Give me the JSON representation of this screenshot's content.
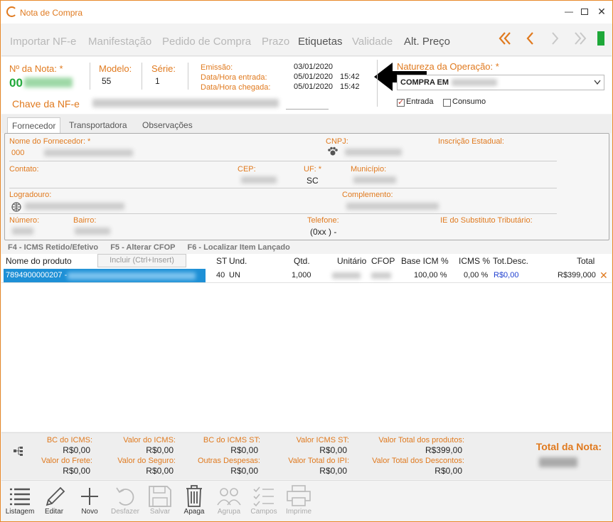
{
  "window": {
    "title": "Nota de Compra"
  },
  "tabs": [
    {
      "label": "Importar NF-e",
      "active": false
    },
    {
      "label": "Manifestação",
      "active": false
    },
    {
      "label": "Pedido de Compra",
      "active": false
    },
    {
      "label": "Prazo",
      "active": false
    },
    {
      "label": "Etiquetas",
      "active": true
    },
    {
      "label": "Validade",
      "active": false
    },
    {
      "label": "Alt. Preço",
      "active": true
    }
  ],
  "header": {
    "nota_label": "Nº da Nota: *",
    "nota_value": "00",
    "modelo_label": "Modelo:",
    "modelo_value": "55",
    "serie_label": "Série:",
    "serie_value": "1",
    "emissao_label": "Emissão:",
    "emissao_value": "03/01/2020",
    "entrada_label": "Data/Hora entrada:",
    "entrada_date": "05/01/2020",
    "entrada_time": "15:42",
    "chegada_label": "Data/Hora chegada:",
    "chegada_date": "05/01/2020",
    "chegada_time": "15:42",
    "chave_label": "Chave da NF-e",
    "natureza_label": "Natureza da Operação: *",
    "natureza_value": "COMPRA EM",
    "entrada_check": "Entrada",
    "consumo_check": "Consumo"
  },
  "subtabs": [
    "Fornecedor",
    "Transportadora",
    "Observações"
  ],
  "fornecedor": {
    "nome_label": "Nome do Fornecedor: *",
    "nome_value": "000",
    "cnpj_label": "CNPJ:",
    "ie_label": "Inscrição Estadual:",
    "contato_label": "Contato:",
    "cep_label": "CEP:",
    "uf_label": "UF: *",
    "uf_value": "SC",
    "municipio_label": "Município:",
    "logradouro_label": "Logradouro:",
    "complemento_label": "Complemento:",
    "numero_label": "Número:",
    "bairro_label": "Bairro:",
    "telefone_label": "Telefone:",
    "telefone_value": "(0xx  )    -",
    "ie_subst_label": "IE do Substituto Tributário:"
  },
  "shortcuts": [
    "F4 - ICMS Retido/Efetivo",
    "F5 - Alterar CFOP",
    "F6 - Localizar Item Lançado"
  ],
  "grid": {
    "incluir_label": "Incluir (Ctrl+Insert)",
    "columns": [
      "Nome do produto",
      "ST",
      "Und.",
      "Qtd.",
      "Unitário",
      "CFOP",
      "Base ICM %",
      "ICMS %",
      "Tot.Desc.",
      "Total"
    ],
    "rows": [
      {
        "produto": "7894900000207 -",
        "st": "40",
        "und": "UN",
        "qtd": "1,000",
        "unitario": "",
        "cfop": "",
        "base_icm": "100,00 %",
        "icms": "0,00 %",
        "desc": "R$0,00",
        "total": "R$399,000"
      }
    ]
  },
  "totals": {
    "bc_icms_label": "BC do ICMS:",
    "bc_icms_value": "R$0,00",
    "valor_icms_label": "Valor do ICMS:",
    "valor_icms_value": "R$0,00",
    "bc_icms_st_label": "BC do ICMS ST:",
    "bc_icms_st_value": "R$0,00",
    "valor_icms_st_label": "Valor ICMS ST:",
    "valor_icms_st_value": "R$0,00",
    "valor_produtos_label": "Valor Total dos produtos:",
    "valor_produtos_value": "R$399,00",
    "frete_label": "Valor do Frete:",
    "frete_value": "R$0,00",
    "seguro_label": "Valor do Seguro:",
    "seguro_value": "R$0,00",
    "outras_label": "Outras Despesas:",
    "outras_value": "R$0,00",
    "ipi_label": "Valor Total do IPI:",
    "ipi_value": "R$0,00",
    "descontos_label": "Valor Total dos Descontos:",
    "descontos_value": "R$0,00",
    "total_nota_label": "Total da Nota:"
  },
  "toolbar": [
    {
      "label": "Listagem",
      "icon": "list-icon",
      "enabled": true
    },
    {
      "label": "Editar",
      "icon": "pencil-icon",
      "enabled": true
    },
    {
      "label": "Novo",
      "icon": "plus-icon",
      "enabled": true
    },
    {
      "label": "Desfazer",
      "icon": "undo-icon",
      "enabled": false
    },
    {
      "label": "Salvar",
      "icon": "save-icon",
      "enabled": false
    },
    {
      "label": "Apaga",
      "icon": "trash-icon",
      "enabled": true
    },
    {
      "label": "Agrupa",
      "icon": "group-icon",
      "enabled": false
    },
    {
      "label": "Campos",
      "icon": "checklist-icon",
      "enabled": false
    },
    {
      "label": "Imprime",
      "icon": "printer-icon",
      "enabled": false
    }
  ],
  "colors": {
    "accent": "#e07a1f",
    "selection": "#1e90d6",
    "indicator": "#1ea839"
  }
}
